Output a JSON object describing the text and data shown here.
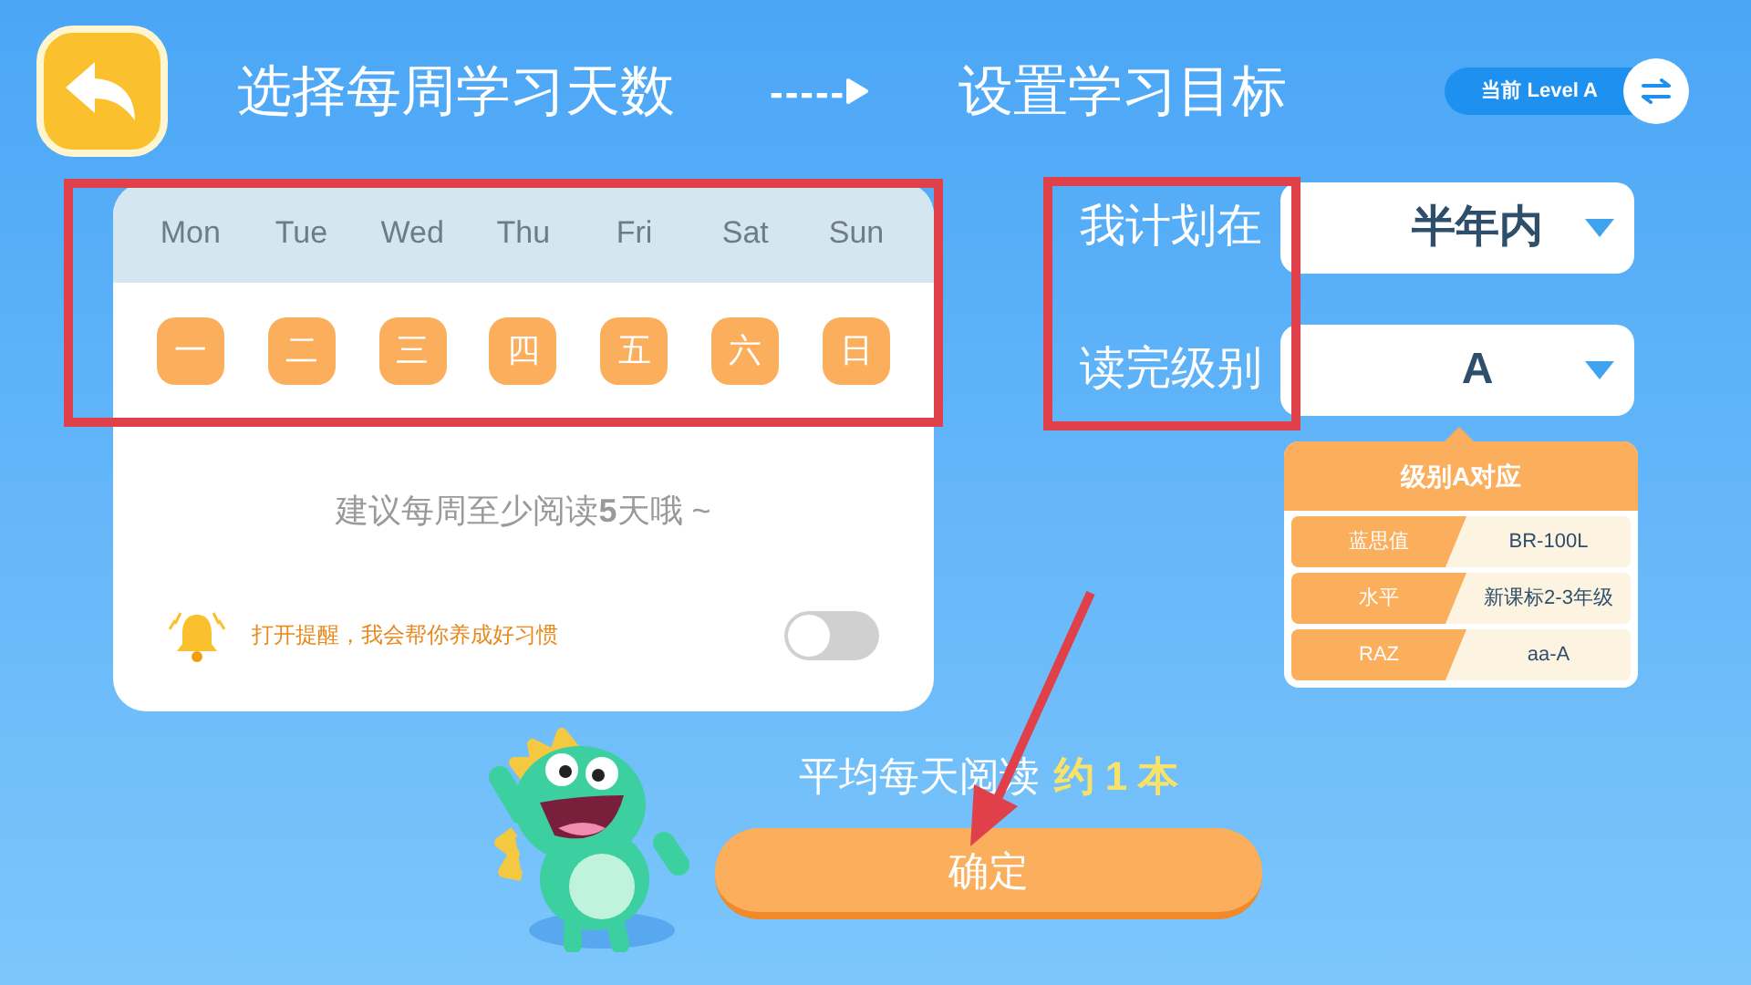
{
  "header": {
    "step_1": "选择每周学习天数",
    "step_arrow": "-----",
    "step_2": "设置学习目标",
    "level_badge": "当前 Level A"
  },
  "week": {
    "days": [
      {
        "label": "Mon",
        "chip": "一",
        "selected": true
      },
      {
        "label": "Tue",
        "chip": "二",
        "selected": true
      },
      {
        "label": "Wed",
        "chip": "三",
        "selected": true
      },
      {
        "label": "Thu",
        "chip": "四",
        "selected": true
      },
      {
        "label": "Fri",
        "chip": "五",
        "selected": true
      },
      {
        "label": "Sat",
        "chip": "六",
        "selected": true
      },
      {
        "label": "Sun",
        "chip": "日",
        "selected": true
      }
    ],
    "hint": "建议每周至少阅读**5**天哦 ~",
    "reminder": {
      "text": "打开提醒，我会帮你养成好习惯",
      "on": false
    }
  },
  "goal": {
    "rows": [
      {
        "label": "我计划在",
        "value": "半年内"
      },
      {
        "label": "读完级别",
        "value": "A"
      }
    ]
  },
  "level_info": {
    "title": "级别A对应",
    "rows": [
      {
        "key": "蓝思值",
        "value": "BR-100L"
      },
      {
        "key": "水平",
        "value": "新课标2-3年级"
      },
      {
        "key": "RAZ",
        "value": "aa-A"
      }
    ]
  },
  "summary": {
    "text": "平均每天阅读",
    "highlight": "约 1 本"
  },
  "confirm_button": "确定"
}
